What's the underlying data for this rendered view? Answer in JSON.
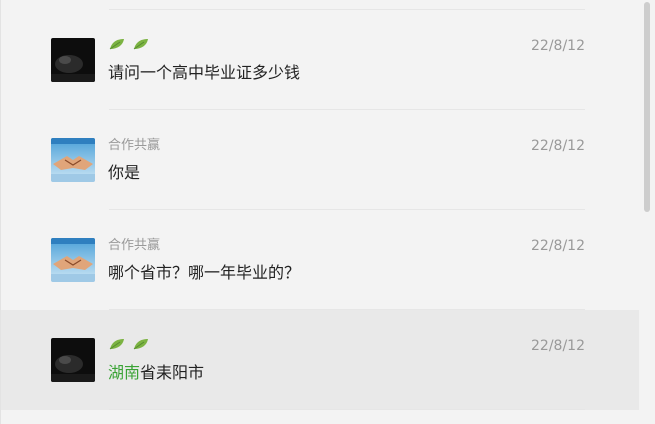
{
  "messages": [
    {
      "avatar": "dark-night-avatar",
      "sender_icons": [
        "leaf-icon",
        "leaf-icon"
      ],
      "sender": "",
      "date": "22/8/12",
      "text_highlight": "",
      "text": "请问一个高中毕业证多少钱"
    },
    {
      "avatar": "handshake-avatar",
      "sender_icons": [],
      "sender": "合作共赢",
      "date": "22/8/12",
      "text_highlight": "",
      "text": "你是"
    },
    {
      "avatar": "handshake-avatar",
      "sender_icons": [],
      "sender": "合作共赢",
      "date": "22/8/12",
      "text_highlight": "",
      "text": "哪个省市？哪一年毕业的？"
    },
    {
      "avatar": "dark-night-avatar",
      "sender_icons": [
        "leaf-icon",
        "leaf-icon"
      ],
      "sender": "",
      "date": "22/8/12",
      "text_highlight": "湖南",
      "text": "省耒阳市"
    }
  ],
  "colors": {
    "background": "#f3f3f3",
    "hover_row": "#e9e9e9",
    "highlight": "#3aa335",
    "secondary_text": "#999999"
  }
}
